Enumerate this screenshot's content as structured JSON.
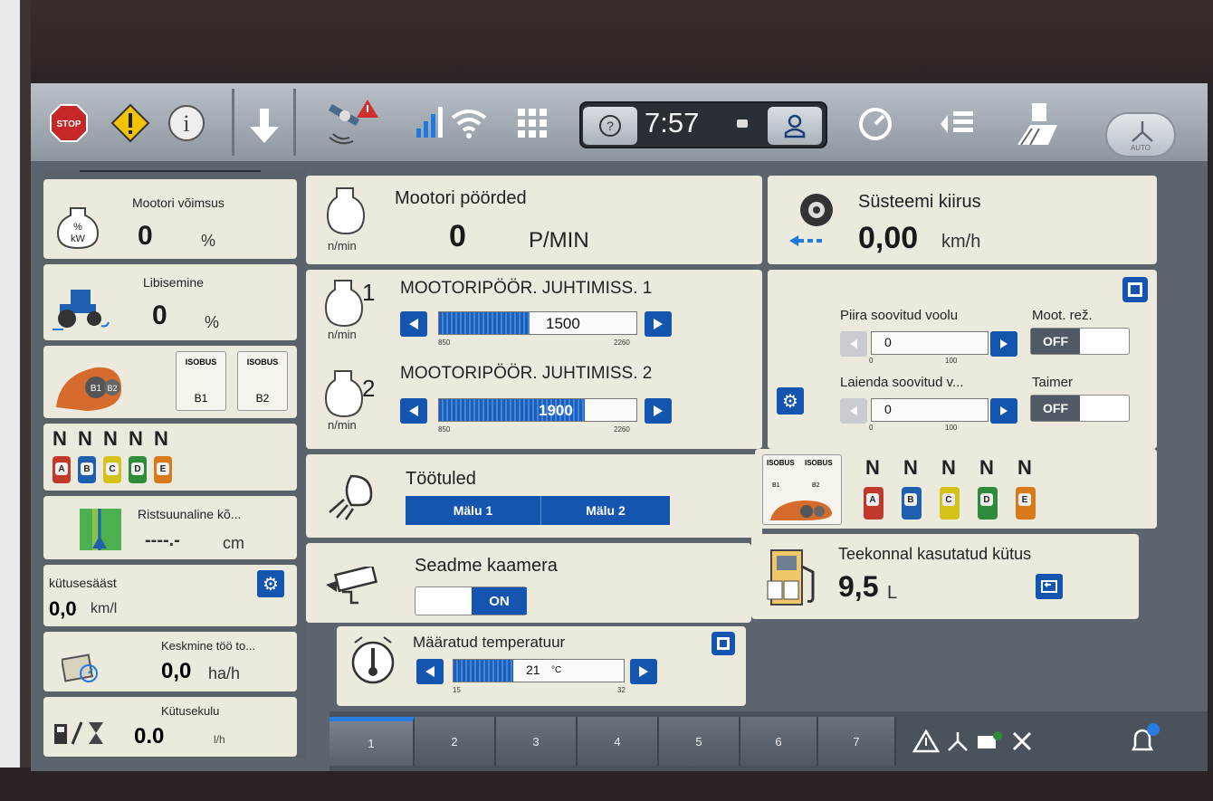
{
  "topbar": {
    "clock": "7:57",
    "auto_label": "AUTO",
    "stop_label": "STOP"
  },
  "left": {
    "engine_power": {
      "label": "Mootori võimsus",
      "value": "0",
      "unit": "%",
      "icon_text": "%\nkW"
    },
    "slip": {
      "label": "Libisemine",
      "value": "0",
      "unit": "%"
    },
    "isobus": {
      "tag1": "ISOBUS",
      "tag2": "ISOBUS",
      "b1": "B1",
      "b2": "B2",
      "dial_b1": "B1",
      "dial_b2": "B2"
    },
    "valves": {
      "letters": [
        "N",
        "N",
        "N",
        "N",
        "N"
      ],
      "chips": [
        "A",
        "B",
        "C",
        "D",
        "E"
      ]
    },
    "cross_track": {
      "label": "Ristsuunaline kõ...",
      "value": "----.-",
      "unit": "cm"
    },
    "fuel_saving": {
      "label": "kütusesääst",
      "value": "0,0",
      "unit": "km/l"
    },
    "avg_work": {
      "label": "Keskmine töö to...",
      "value": "0,0",
      "unit": "ha/h"
    },
    "fuel_use": {
      "label": "Kütusekulu",
      "value": "0.0",
      "unit": "l/h"
    }
  },
  "engine_rpm": {
    "title": "Mootori pöörded",
    "value": "0",
    "unit": "P/MIN",
    "sub": "n/min"
  },
  "speed": {
    "title": "Süsteemi kiirus",
    "value": "0,00",
    "unit": "km/h"
  },
  "rpm_control": {
    "title1": "MOOTORIPÖÖR. JUHTIMISS. 1",
    "num1": "1",
    "value1": "1500",
    "min1": "850",
    "max1": "2260",
    "fill1": 0.46,
    "title2": "MOOTORIPÖÖR. JUHTIMISS. 2",
    "num2": "2",
    "value2": "1900",
    "min2": "850",
    "max2": "2260",
    "fill2": 0.74,
    "sub": "n/min"
  },
  "flow": {
    "limit_label": "Piira soovitud voolu",
    "limit_value": "0",
    "limit_min": "0",
    "limit_max": "100",
    "extend_label": "Laienda soovitud v...",
    "extend_value": "0",
    "extend_min": "0",
    "extend_max": "100",
    "mode_label": "Moot. rež.",
    "mode_state": "OFF",
    "timer_label": "Taimer",
    "timer_state": "OFF"
  },
  "worklights": {
    "title": "Töötuled",
    "mem1": "Mälu 1",
    "mem2": "Mälu 2"
  },
  "isobus_right": {
    "tag1": "ISOBUS",
    "tag2": "ISOBUS",
    "b1": "B1",
    "b2": "B2",
    "letters": [
      "N",
      "N",
      "N",
      "N",
      "N"
    ],
    "chips": [
      "A",
      "B",
      "C",
      "D",
      "E"
    ]
  },
  "camera": {
    "title": "Seadme kaamera",
    "state": "ON"
  },
  "trip_fuel": {
    "title": "Teekonnal kasutatud kütus",
    "value": "9,5",
    "unit": "L"
  },
  "temperature": {
    "title": "Määratud temperatuur",
    "value": "21",
    "unit": "°C",
    "min": "15",
    "max": "32",
    "fill": 0.35
  },
  "tabs": [
    "1",
    "2",
    "3",
    "4",
    "5",
    "6",
    "7"
  ],
  "colors": {
    "accent": "#1455b0",
    "panel": "#ece9dd",
    "chipA": "#c0392b",
    "chipB": "#1f5fb0",
    "chipC": "#d4c21a",
    "chipD": "#2e8b3a",
    "chipE": "#d87a1a"
  }
}
